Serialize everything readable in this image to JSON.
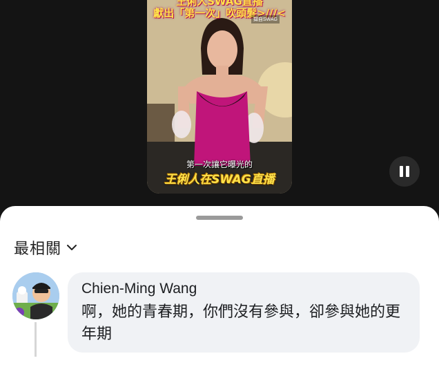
{
  "video": {
    "caption_top_line1": "王俐人SWAG直播",
    "caption_top_line2": "獻出「第一次」吹頭髮>///<",
    "watermark": "擷自SWAG",
    "subtitle": "第一次讓它曝光的",
    "banner": "王俐人在SWAG直播"
  },
  "controls": {
    "pause_icon": "pause-icon"
  },
  "comments": {
    "sort_label": "最相關",
    "sort_icon": "chevron-down-icon",
    "items": [
      {
        "author": "Chien-Ming Wang",
        "text": "啊，她的青春期，你們沒有參與，卻參與她的更年期"
      }
    ]
  },
  "colors": {
    "background": "#141414",
    "sheet": "#ffffff",
    "bubble": "#f0f2f5",
    "caption_yellow": "#ffe24a",
    "dress_magenta": "#c0157a"
  }
}
